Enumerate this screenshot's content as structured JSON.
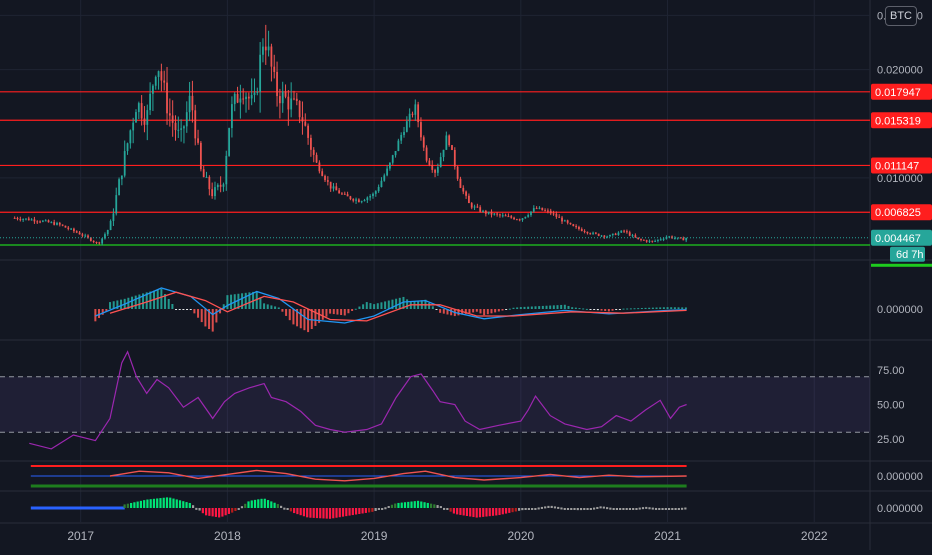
{
  "symbol": "BTC",
  "countdown": "6d 7h",
  "colors": {
    "background": "#131722",
    "grid": "#1f2433",
    "up": "#26a69a",
    "down": "#ef5350",
    "hline": "#ff1e1e",
    "support": "#1ecb1e",
    "rsi": "#9c27b0",
    "macd": "#2196f3",
    "signal": "#ff5252",
    "axis_text": "#b2b5be"
  },
  "chart_data": [
    {
      "type": "candlestick",
      "pane": "price",
      "x_labels": [
        "2017",
        "2018",
        "2019",
        "2020",
        "2021",
        "2022"
      ],
      "y_tick_labels": [
        "0.025000",
        "0.020000",
        "0.010000"
      ],
      "ylim": [
        0.0026,
        0.0255
      ],
      "horizontal_levels": [
        {
          "value": 0.017947,
          "label": "0.017947"
        },
        {
          "value": 0.015319,
          "label": "0.015319"
        },
        {
          "value": 0.011147,
          "label": "0.011147"
        },
        {
          "value": 0.006825,
          "label": "0.006825"
        }
      ],
      "support_level": 0.0038,
      "last_price": {
        "value": 0.004467,
        "label": "0.004467"
      },
      "close_path": [
        [
          2016.55,
          0.0063
        ],
        [
          2016.7,
          0.0061
        ],
        [
          2016.85,
          0.0057
        ],
        [
          2017.0,
          0.0048
        ],
        [
          2017.12,
          0.0039
        ],
        [
          2017.2,
          0.0055
        ],
        [
          2017.3,
          0.012
        ],
        [
          2017.38,
          0.017
        ],
        [
          2017.45,
          0.0155
        ],
        [
          2017.52,
          0.021
        ],
        [
          2017.6,
          0.016
        ],
        [
          2017.68,
          0.0135
        ],
        [
          2017.75,
          0.0175
        ],
        [
          2017.82,
          0.0105
        ],
        [
          2017.9,
          0.0085
        ],
        [
          2017.97,
          0.0095
        ],
        [
          2018.02,
          0.016
        ],
        [
          2018.1,
          0.0185
        ],
        [
          2018.18,
          0.0165
        ],
        [
          2018.25,
          0.0235
        ],
        [
          2018.33,
          0.018
        ],
        [
          2018.42,
          0.017
        ],
        [
          2018.5,
          0.016
        ],
        [
          2018.6,
          0.0115
        ],
        [
          2018.7,
          0.0092
        ],
        [
          2018.8,
          0.0083
        ],
        [
          2018.9,
          0.0079
        ],
        [
          2019.0,
          0.0085
        ],
        [
          2019.1,
          0.011
        ],
        [
          2019.2,
          0.0145
        ],
        [
          2019.28,
          0.0165
        ],
        [
          2019.35,
          0.012
        ],
        [
          2019.42,
          0.0105
        ],
        [
          2019.5,
          0.014
        ],
        [
          2019.58,
          0.0095
        ],
        [
          2019.65,
          0.0075
        ],
        [
          2019.75,
          0.0068
        ],
        [
          2019.9,
          0.0064
        ],
        [
          2020.0,
          0.0062
        ],
        [
          2020.1,
          0.0072
        ],
        [
          2020.2,
          0.0068
        ],
        [
          2020.35,
          0.0055
        ],
        [
          2020.5,
          0.0048
        ],
        [
          2020.6,
          0.0046
        ],
        [
          2020.7,
          0.0051
        ],
        [
          2020.8,
          0.0043
        ],
        [
          2020.9,
          0.0041
        ],
        [
          2021.0,
          0.0046
        ],
        [
          2021.1,
          0.0043
        ],
        [
          2021.13,
          0.004467
        ]
      ]
    },
    {
      "type": "line",
      "pane": "macd",
      "y_tick_labels": [
        "0.000000"
      ],
      "series": [
        {
          "color_key": "macd",
          "values": [
            [
              2017.1,
              -0.001
            ],
            [
              2017.3,
              0.0007
            ],
            [
              2017.55,
              0.003
            ],
            [
              2017.75,
              0.0018
            ],
            [
              2017.9,
              -0.0008
            ],
            [
              2018.0,
              0.0005
            ],
            [
              2018.2,
              0.0025
            ],
            [
              2018.35,
              0.0015
            ],
            [
              2018.55,
              -0.0015
            ],
            [
              2018.8,
              -0.002
            ],
            [
              2019.0,
              -0.001
            ],
            [
              2019.2,
              0.001
            ],
            [
              2019.35,
              0.0012
            ],
            [
              2019.55,
              -0.0005
            ],
            [
              2019.75,
              -0.0014
            ],
            [
              2020.0,
              -0.0008
            ],
            [
              2020.3,
              -0.0002
            ],
            [
              2020.6,
              -0.0007
            ],
            [
              2021.0,
              -0.0002
            ],
            [
              2021.13,
              -0.0001
            ]
          ]
        },
        {
          "color_key": "signal",
          "values": [
            [
              2017.2,
              -0.0006
            ],
            [
              2017.45,
              0.001
            ],
            [
              2017.65,
              0.0024
            ],
            [
              2017.85,
              0.0012
            ],
            [
              2018.0,
              -0.0004
            ],
            [
              2018.25,
              0.0018
            ],
            [
              2018.45,
              0.001
            ],
            [
              2018.7,
              -0.0015
            ],
            [
              2018.95,
              -0.0017
            ],
            [
              2019.25,
              0.0006
            ],
            [
              2019.45,
              0.0006
            ],
            [
              2019.7,
              -0.001
            ],
            [
              2019.95,
              -0.001
            ],
            [
              2020.35,
              -0.0004
            ],
            [
              2020.7,
              -0.0006
            ],
            [
              2021.13,
              -0.0002
            ]
          ]
        }
      ]
    },
    {
      "type": "line",
      "pane": "rsi",
      "y_tick_labels": [
        "75.00",
        "50.00",
        "25.00"
      ],
      "bands": [
        70,
        30
      ],
      "ylim": [
        10,
        95
      ],
      "values": [
        [
          2016.65,
          22
        ],
        [
          2016.8,
          18
        ],
        [
          2016.95,
          28
        ],
        [
          2017.1,
          24
        ],
        [
          2017.2,
          40
        ],
        [
          2017.28,
          80
        ],
        [
          2017.32,
          88
        ],
        [
          2017.38,
          70
        ],
        [
          2017.45,
          58
        ],
        [
          2017.52,
          68
        ],
        [
          2017.6,
          62
        ],
        [
          2017.7,
          48
        ],
        [
          2017.8,
          55
        ],
        [
          2017.9,
          40
        ],
        [
          2017.98,
          52
        ],
        [
          2018.05,
          58
        ],
        [
          2018.15,
          62
        ],
        [
          2018.25,
          65
        ],
        [
          2018.3,
          55
        ],
        [
          2018.4,
          52
        ],
        [
          2018.5,
          45
        ],
        [
          2018.6,
          35
        ],
        [
          2018.7,
          32
        ],
        [
          2018.8,
          30
        ],
        [
          2018.95,
          32
        ],
        [
          2019.05,
          36
        ],
        [
          2019.15,
          55
        ],
        [
          2019.25,
          70
        ],
        [
          2019.32,
          72
        ],
        [
          2019.4,
          60
        ],
        [
          2019.45,
          52
        ],
        [
          2019.55,
          50
        ],
        [
          2019.62,
          38
        ],
        [
          2019.72,
          32
        ],
        [
          2019.85,
          35
        ],
        [
          2020.0,
          38
        ],
        [
          2020.05,
          46
        ],
        [
          2020.1,
          56
        ],
        [
          2020.2,
          42
        ],
        [
          2020.3,
          36
        ],
        [
          2020.45,
          32
        ],
        [
          2020.55,
          34
        ],
        [
          2020.65,
          42
        ],
        [
          2020.75,
          38
        ],
        [
          2020.85,
          46
        ],
        [
          2020.95,
          53
        ],
        [
          2021.02,
          40
        ],
        [
          2021.08,
          48
        ],
        [
          2021.13,
          50
        ]
      ]
    },
    {
      "type": "area",
      "pane": "oscillator",
      "y_tick_labels": [
        "0.000000"
      ],
      "values": [
        [
          2017.2,
          0.0
        ],
        [
          2017.4,
          0.6
        ],
        [
          2017.6,
          0.4
        ],
        [
          2017.8,
          -0.3
        ],
        [
          2018.0,
          0.2
        ],
        [
          2018.2,
          0.7
        ],
        [
          2018.4,
          0.3
        ],
        [
          2018.6,
          -0.4
        ],
        [
          2018.8,
          -0.6
        ],
        [
          2019.0,
          -0.3
        ],
        [
          2019.2,
          0.3
        ],
        [
          2019.35,
          0.6
        ],
        [
          2019.55,
          -0.2
        ],
        [
          2019.75,
          -0.5
        ],
        [
          2020.0,
          -0.2
        ],
        [
          2020.2,
          0.2
        ],
        [
          2020.4,
          -0.2
        ],
        [
          2020.6,
          0.1
        ],
        [
          2020.8,
          -0.1
        ],
        [
          2021.13,
          0.0
        ]
      ]
    },
    {
      "type": "bar",
      "pane": "momentum",
      "y_tick_labels": [
        "0.000000"
      ],
      "values": [
        [
          2017.3,
          0.3
        ],
        [
          2017.45,
          0.7
        ],
        [
          2017.6,
          0.9
        ],
        [
          2017.75,
          0.4
        ],
        [
          2017.85,
          -0.6
        ],
        [
          2017.95,
          -0.8
        ],
        [
          2018.05,
          -0.3
        ],
        [
          2018.15,
          0.6
        ],
        [
          2018.25,
          0.8
        ],
        [
          2018.35,
          0.3
        ],
        [
          2018.45,
          -0.4
        ],
        [
          2018.55,
          -0.8
        ],
        [
          2018.7,
          -0.9
        ],
        [
          2018.85,
          -0.6
        ],
        [
          2019.0,
          -0.3
        ],
        [
          2019.15,
          0.4
        ],
        [
          2019.3,
          0.6
        ],
        [
          2019.45,
          0.2
        ],
        [
          2019.55,
          -0.5
        ],
        [
          2019.7,
          -0.8
        ],
        [
          2019.85,
          -0.6
        ],
        [
          2020.0,
          -0.2
        ],
        [
          2020.2,
          0.2
        ],
        [
          2020.4,
          -0.2
        ],
        [
          2020.55,
          0.15
        ],
        [
          2020.7,
          -0.15
        ],
        [
          2020.85,
          0.1
        ],
        [
          2021.0,
          -0.1
        ],
        [
          2021.13,
          0.05
        ]
      ]
    }
  ]
}
